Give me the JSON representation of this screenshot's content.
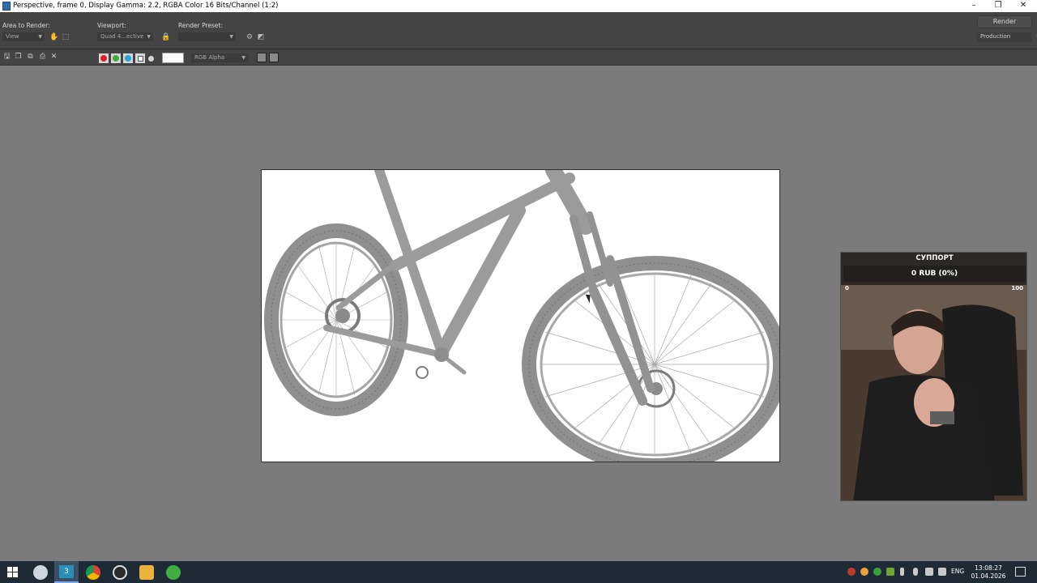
{
  "window": {
    "title": "Perspective, frame 0, Display Gamma: 2.2, RGBA Color 16 Bits/Channel (1:2)",
    "minimize": "–",
    "restore": "❐",
    "close": "✕"
  },
  "controls": {
    "area_label": "Area to Render:",
    "area_value": "View",
    "viewport_label": "Viewport:",
    "viewport_value": "Quad 4...ective",
    "preset_label": "Render Preset:",
    "preset_value": "",
    "render_button": "Render",
    "production_value": "Production"
  },
  "toolbar": {
    "channel_value": "RGB Alpha",
    "channels": [
      {
        "name": "red",
        "color": "#e01f2a"
      },
      {
        "name": "green",
        "color": "#3fae3f"
      },
      {
        "name": "blue",
        "color": "#2aa4d6"
      }
    ]
  },
  "overlay": {
    "title": "СУППОРТ",
    "progress_text": "0 RUB (0%)",
    "progress": 0,
    "min": "0",
    "max": "100"
  },
  "taskbar": {
    "language": "ENG",
    "time": "13:08:27",
    "date": "01.04.2026",
    "apps": [
      "windows-icon",
      "search-icon",
      "3dsmax-icon",
      "chrome-icon",
      "obs-icon",
      "folder-icon",
      "torrent-icon"
    ]
  }
}
